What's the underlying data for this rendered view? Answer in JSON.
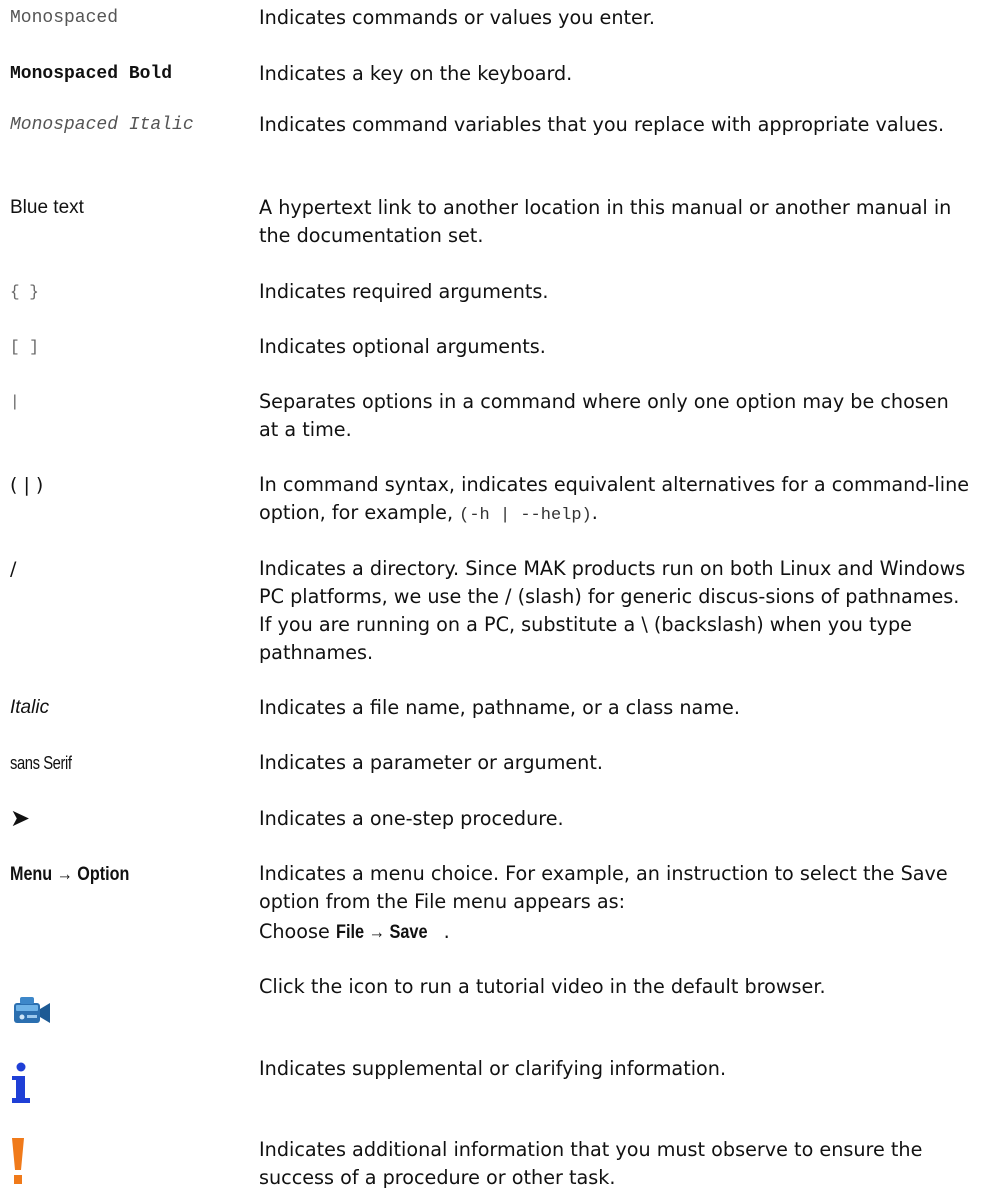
{
  "rows": [
    {
      "term": "Monospaced",
      "desc": "Indicates commands or values you enter."
    },
    {
      "term": "Monospaced Bold",
      "desc": "Indicates a key on the keyboard."
    },
    {
      "term": "Monospaced Italic",
      "desc": "Indicates command variables that you replace with appropriate values."
    },
    {
      "term": "Blue text",
      "desc": "A hypertext link to another location in this manual or another manual in the documentation set."
    },
    {
      "term": "{ }",
      "desc": "Indicates required arguments."
    },
    {
      "term": "[ ]",
      "desc": "Indicates optional arguments."
    },
    {
      "term": "|",
      "desc": "Separates options in a command where only one option may be chosen at a time."
    },
    {
      "term": "( | )",
      "desc_before": "In command syntax, indicates equivalent alternatives for a command-line option, for example, ",
      "desc_code": "(-h | --help)",
      "desc_after": "."
    },
    {
      "term": "/",
      "desc": "Indicates a directory. Since MAK products run on both Linux and Windows PC platforms, we use the / (slash) for generic discus-sions of pathnames. If you are running on a PC, substitute a \\ (backslash) when you type pathnames."
    },
    {
      "term": "Italic",
      "desc": "Indicates a file name, pathname, or a class name."
    },
    {
      "term": "sans Serif",
      "desc": "Indicates a parameter or argument."
    },
    {
      "term": "➤",
      "desc": "Indicates a one-step procedure."
    },
    {
      "term": "Menu → Option",
      "desc": "Indicates a menu choice. For example, an instruction to select the Save option from the File menu appears as:",
      "example_prefix": "Choose ",
      "example_menu": "File → Save",
      "example_suffix": "."
    },
    {
      "icon": "video-camera-icon",
      "desc": "Click the icon to run a tutorial video in the default browser."
    },
    {
      "icon": "info-icon",
      "desc": "Indicates supplemental or clarifying information."
    },
    {
      "icon": "exclamation-icon",
      "desc": "Indicates additional information that you must observe to ensure the success of a procedure or other task."
    }
  ],
  "colors": {
    "info": "#1f3fd6",
    "warning": "#f07a1a",
    "camera": "#2b6fb0"
  }
}
